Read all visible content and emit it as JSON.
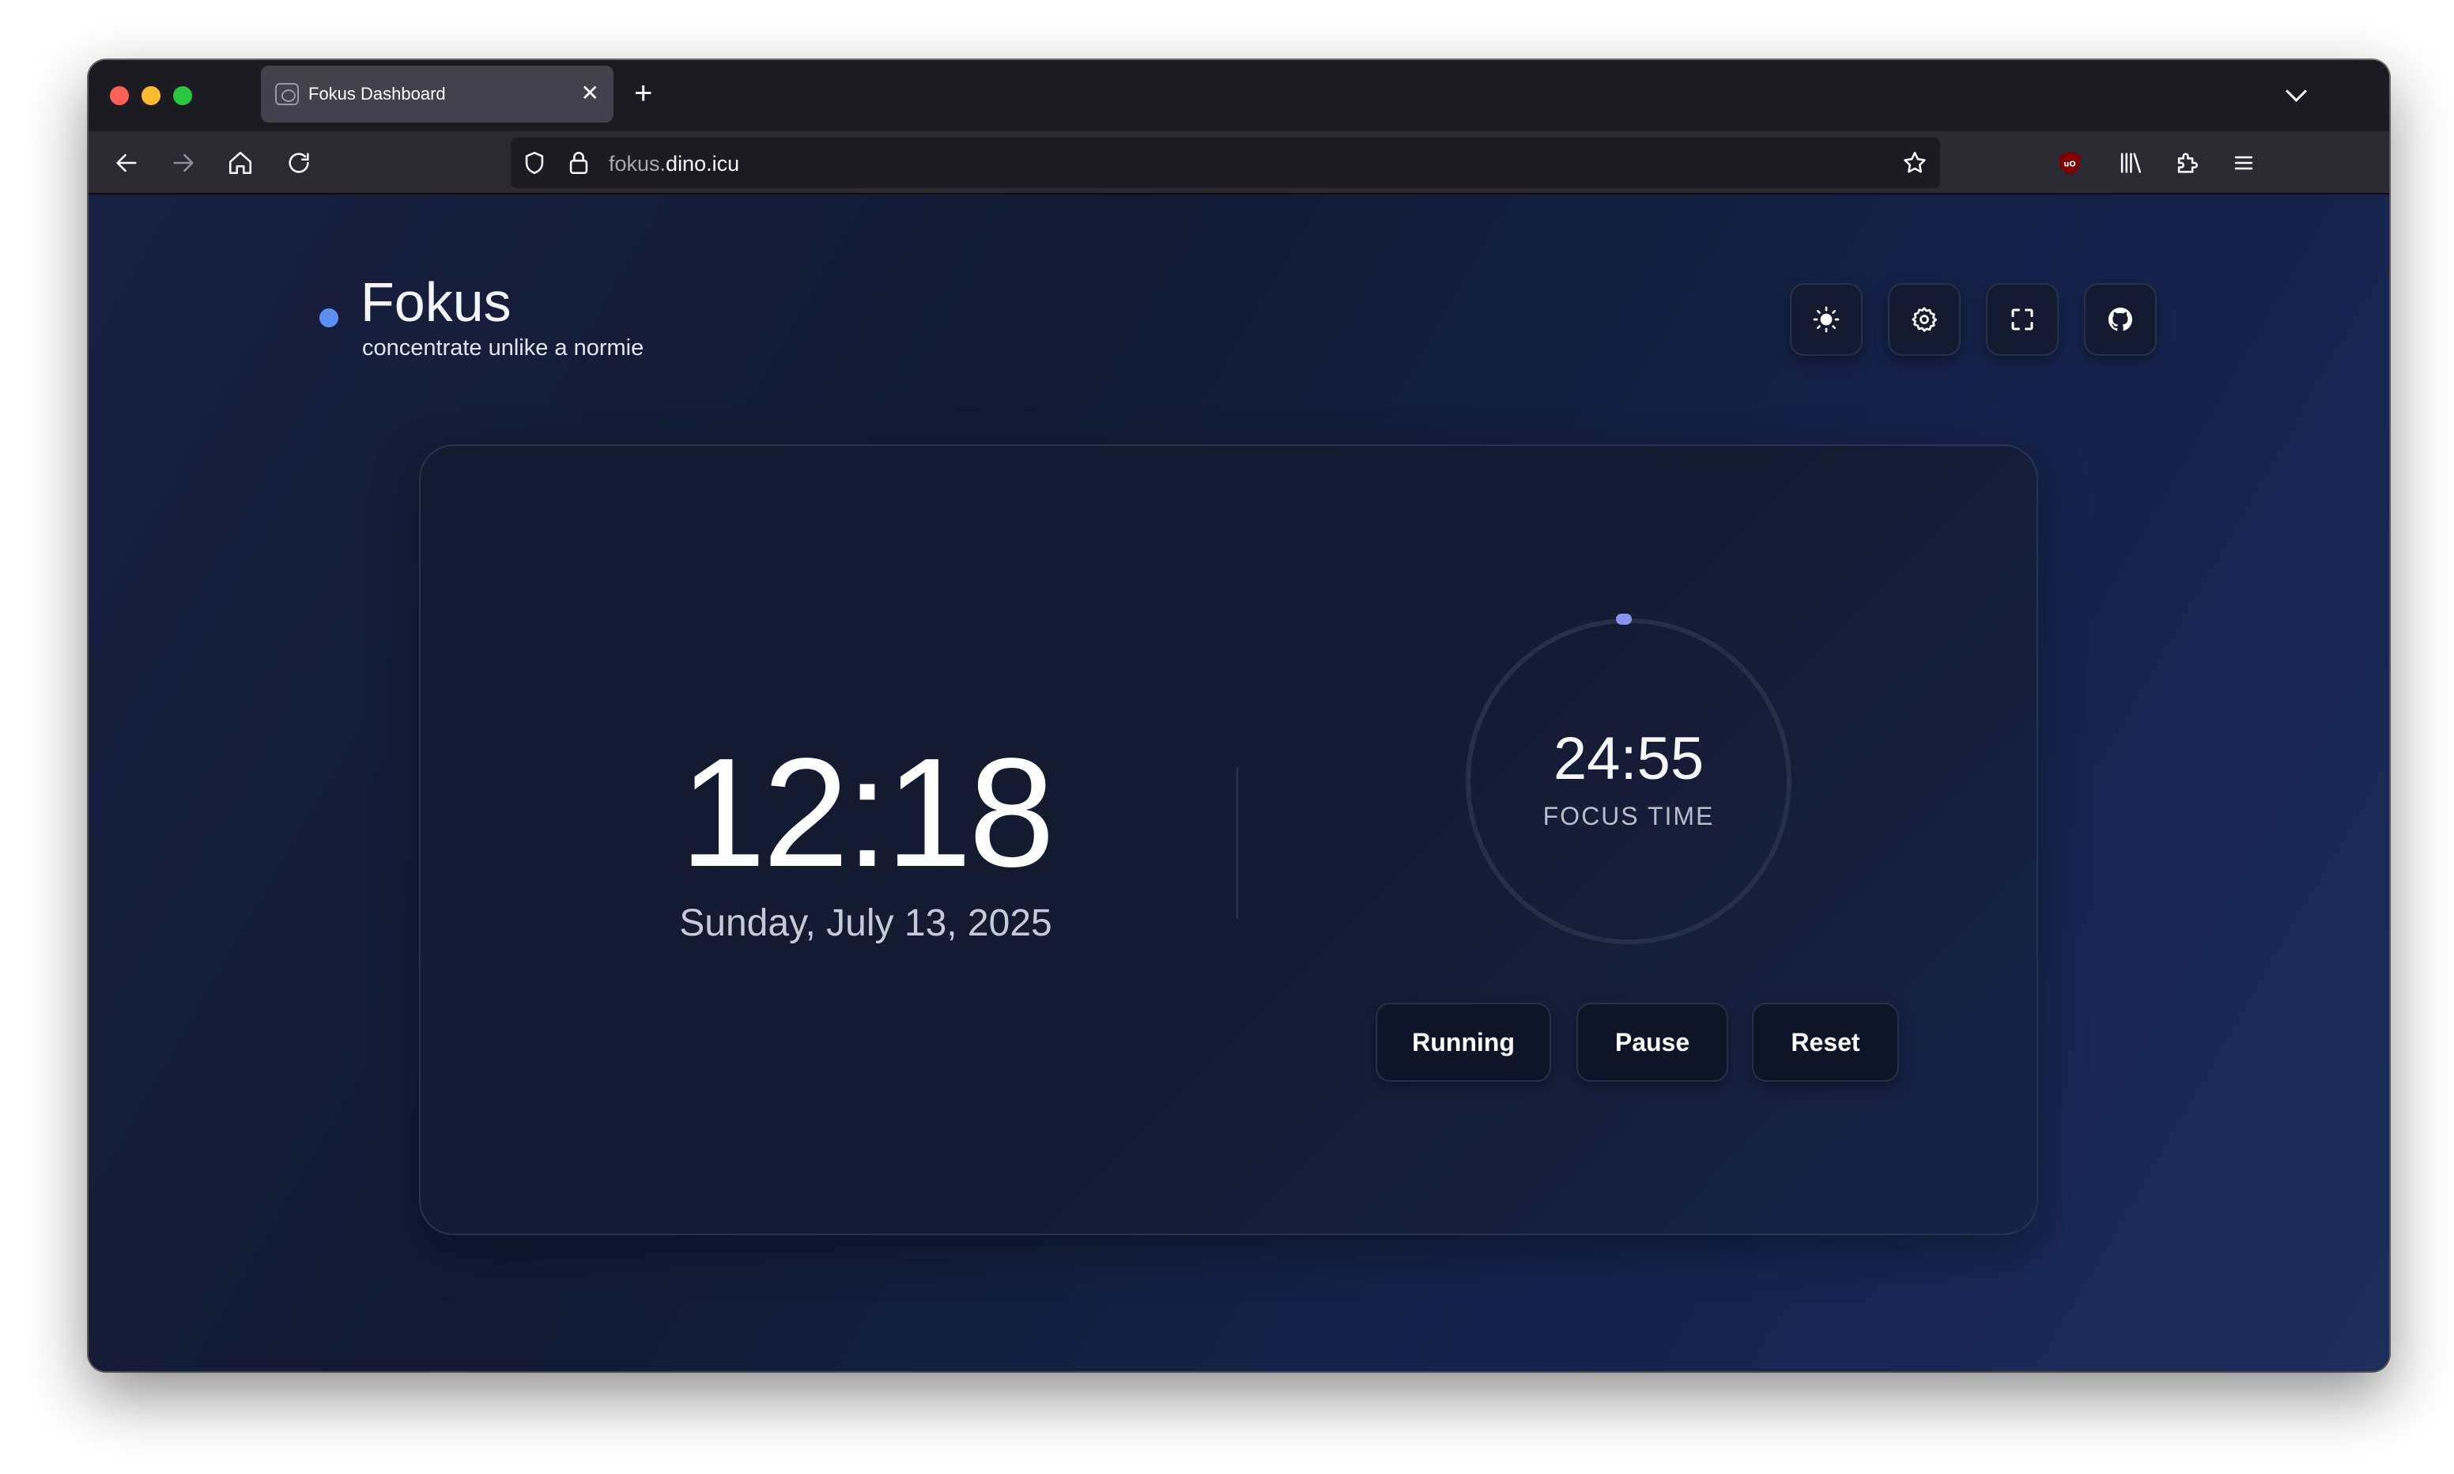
{
  "browser": {
    "tab_title": "Fokus Dashboard",
    "tab_close": "✕",
    "new_tab": "+",
    "url_subdomain": "fokus.",
    "url_domain": "dino.icu"
  },
  "header": {
    "title": "Fokus",
    "subtitle": "concentrate unlike a normie"
  },
  "clock": {
    "time": "12:18",
    "date": "Sunday, July 13, 2025"
  },
  "timer": {
    "value": "24:55",
    "label": "FOCUS TIME"
  },
  "controls": {
    "running": "Running",
    "pause": "Pause",
    "reset": "Reset"
  },
  "colors": {
    "accent_dot": "#5b8ff0",
    "progress_dot": "#8b93f0"
  }
}
